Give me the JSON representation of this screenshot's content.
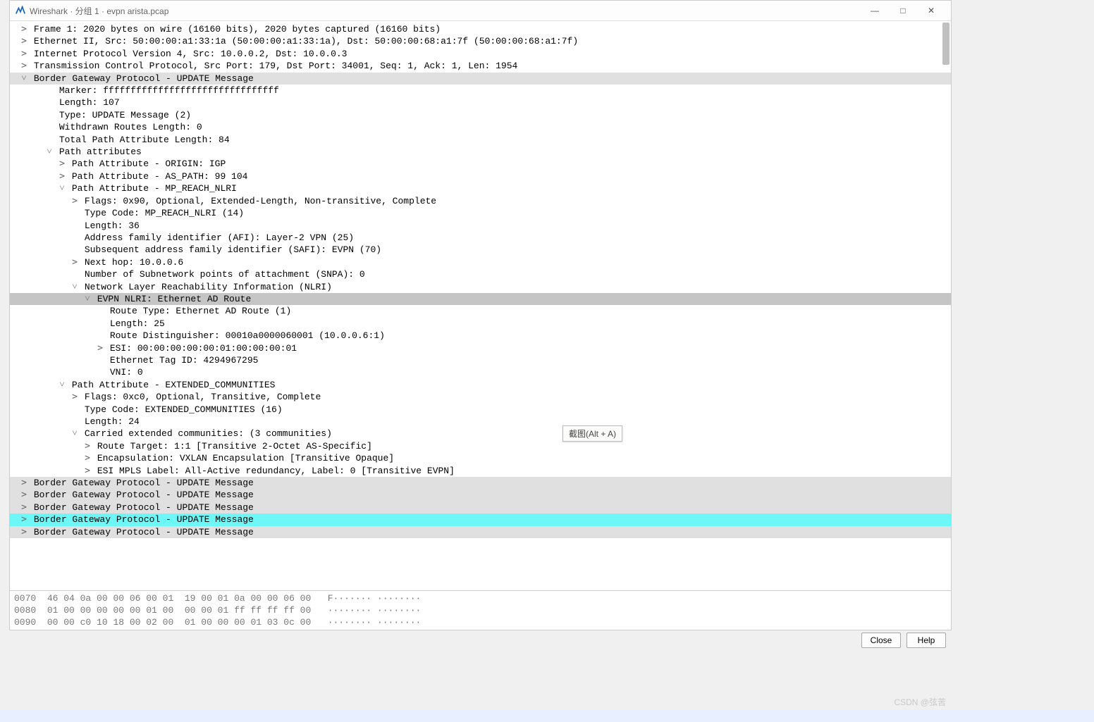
{
  "window": {
    "title": "Wireshark · 分组 1 · evpn arista.pcap",
    "min": "—",
    "max": "□",
    "close": "✕"
  },
  "tooltip": "截图(Alt + A)",
  "watermark": "CSDN @弦苦",
  "buttons": {
    "close": "Close",
    "help": "Help"
  },
  "tree": [
    {
      "ind": 0,
      "exp": "closed",
      "text": "Frame 1: 2020 bytes on wire (16160 bits), 2020 bytes captured (16160 bits)"
    },
    {
      "ind": 0,
      "exp": "closed",
      "text": "Ethernet II, Src: 50:00:00:a1:33:1a (50:00:00:a1:33:1a), Dst: 50:00:00:68:a1:7f (50:00:00:68:a1:7f)"
    },
    {
      "ind": 0,
      "exp": "closed",
      "text": "Internet Protocol Version 4, Src: 10.0.0.2, Dst: 10.0.0.3"
    },
    {
      "ind": 0,
      "exp": "closed",
      "text": "Transmission Control Protocol, Src Port: 179, Dst Port: 34001, Seq: 1, Ack: 1, Len: 1954"
    },
    {
      "ind": 0,
      "exp": "open",
      "text": "Border Gateway Protocol - UPDATE Message",
      "sel": "sel-row"
    },
    {
      "ind": 2,
      "exp": "none",
      "text": "Marker: ffffffffffffffffffffffffffffffff"
    },
    {
      "ind": 2,
      "exp": "none",
      "text": "Length: 107"
    },
    {
      "ind": 2,
      "exp": "none",
      "text": "Type: UPDATE Message (2)"
    },
    {
      "ind": 2,
      "exp": "none",
      "text": "Withdrawn Routes Length: 0"
    },
    {
      "ind": 2,
      "exp": "none",
      "text": "Total Path Attribute Length: 84"
    },
    {
      "ind": 2,
      "exp": "open",
      "text": "Path attributes"
    },
    {
      "ind": 3,
      "exp": "closed",
      "text": "Path Attribute - ORIGIN: IGP"
    },
    {
      "ind": 3,
      "exp": "closed",
      "text": "Path Attribute - AS_PATH: 99 104"
    },
    {
      "ind": 3,
      "exp": "open",
      "text": "Path Attribute - MP_REACH_NLRI"
    },
    {
      "ind": 4,
      "exp": "closed",
      "text": "Flags: 0x90, Optional, Extended-Length, Non-transitive, Complete"
    },
    {
      "ind": 4,
      "exp": "none",
      "text": "Type Code: MP_REACH_NLRI (14)"
    },
    {
      "ind": 4,
      "exp": "none",
      "text": "Length: 36"
    },
    {
      "ind": 4,
      "exp": "none",
      "text": "Address family identifier (AFI): Layer-2 VPN (25)"
    },
    {
      "ind": 4,
      "exp": "none",
      "text": "Subsequent address family identifier (SAFI): EVPN (70)"
    },
    {
      "ind": 4,
      "exp": "closed",
      "text": "Next hop: 10.0.0.6"
    },
    {
      "ind": 4,
      "exp": "none",
      "text": "Number of Subnetwork points of attachment (SNPA): 0"
    },
    {
      "ind": 4,
      "exp": "open",
      "text": "Network Layer Reachability Information (NLRI)"
    },
    {
      "ind": 5,
      "exp": "open",
      "text": "EVPN NLRI: Ethernet AD Route",
      "sel": "selected"
    },
    {
      "ind": 6,
      "exp": "none",
      "text": "Route Type: Ethernet AD Route (1)"
    },
    {
      "ind": 6,
      "exp": "none",
      "text": "Length: 25"
    },
    {
      "ind": 6,
      "exp": "none",
      "text": "Route Distinguisher: 00010a0000060001 (10.0.0.6:1)"
    },
    {
      "ind": 6,
      "exp": "closed",
      "text": "ESI: 00:00:00:00:00:01:00:00:00:01"
    },
    {
      "ind": 6,
      "exp": "none",
      "text": "Ethernet Tag ID: 4294967295"
    },
    {
      "ind": 6,
      "exp": "none",
      "text": "VNI: 0"
    },
    {
      "ind": 3,
      "exp": "open",
      "text": "Path Attribute - EXTENDED_COMMUNITIES"
    },
    {
      "ind": 4,
      "exp": "closed",
      "text": "Flags: 0xc0, Optional, Transitive, Complete"
    },
    {
      "ind": 4,
      "exp": "none",
      "text": "Type Code: EXTENDED_COMMUNITIES (16)"
    },
    {
      "ind": 4,
      "exp": "none",
      "text": "Length: 24"
    },
    {
      "ind": 4,
      "exp": "open",
      "text": "Carried extended communities: (3 communities)"
    },
    {
      "ind": 5,
      "exp": "closed",
      "text": "Route Target: 1:1 [Transitive 2-Octet AS-Specific]"
    },
    {
      "ind": 5,
      "exp": "closed",
      "text": "Encapsulation: VXLAN Encapsulation [Transitive Opaque]"
    },
    {
      "ind": 5,
      "exp": "closed",
      "text": "ESI MPLS Label: All-Active redundancy, Label: 0 [Transitive EVPN]"
    },
    {
      "ind": 0,
      "exp": "closed",
      "text": "Border Gateway Protocol - UPDATE Message",
      "sel": "sel-row"
    },
    {
      "ind": 0,
      "exp": "closed",
      "text": "Border Gateway Protocol - UPDATE Message",
      "sel": "sel-row"
    },
    {
      "ind": 0,
      "exp": "closed",
      "text": "Border Gateway Protocol - UPDATE Message",
      "sel": "sel-row"
    },
    {
      "ind": 0,
      "exp": "closed",
      "text": "Border Gateway Protocol - UPDATE Message",
      "sel": "highlighted"
    },
    {
      "ind": 0,
      "exp": "closed",
      "text": "Border Gateway Protocol - UPDATE Message",
      "sel": "sel-row"
    }
  ],
  "hex": [
    {
      "off": "0070",
      "bytes": "46 04 0a 00 00 06 00 01  19 00 01 0a 00 00 06 00",
      "ascii": "F······· ········"
    },
    {
      "off": "0080",
      "bytes": "01 00 00 00 00 00 01 00  00 00 01 ff ff ff ff 00",
      "ascii": "········ ········"
    },
    {
      "off": "0090",
      "bytes": "00 00 c0 10 18 00 02 00  01 00 00 00 01 03 0c 00",
      "ascii": "········ ········"
    }
  ]
}
